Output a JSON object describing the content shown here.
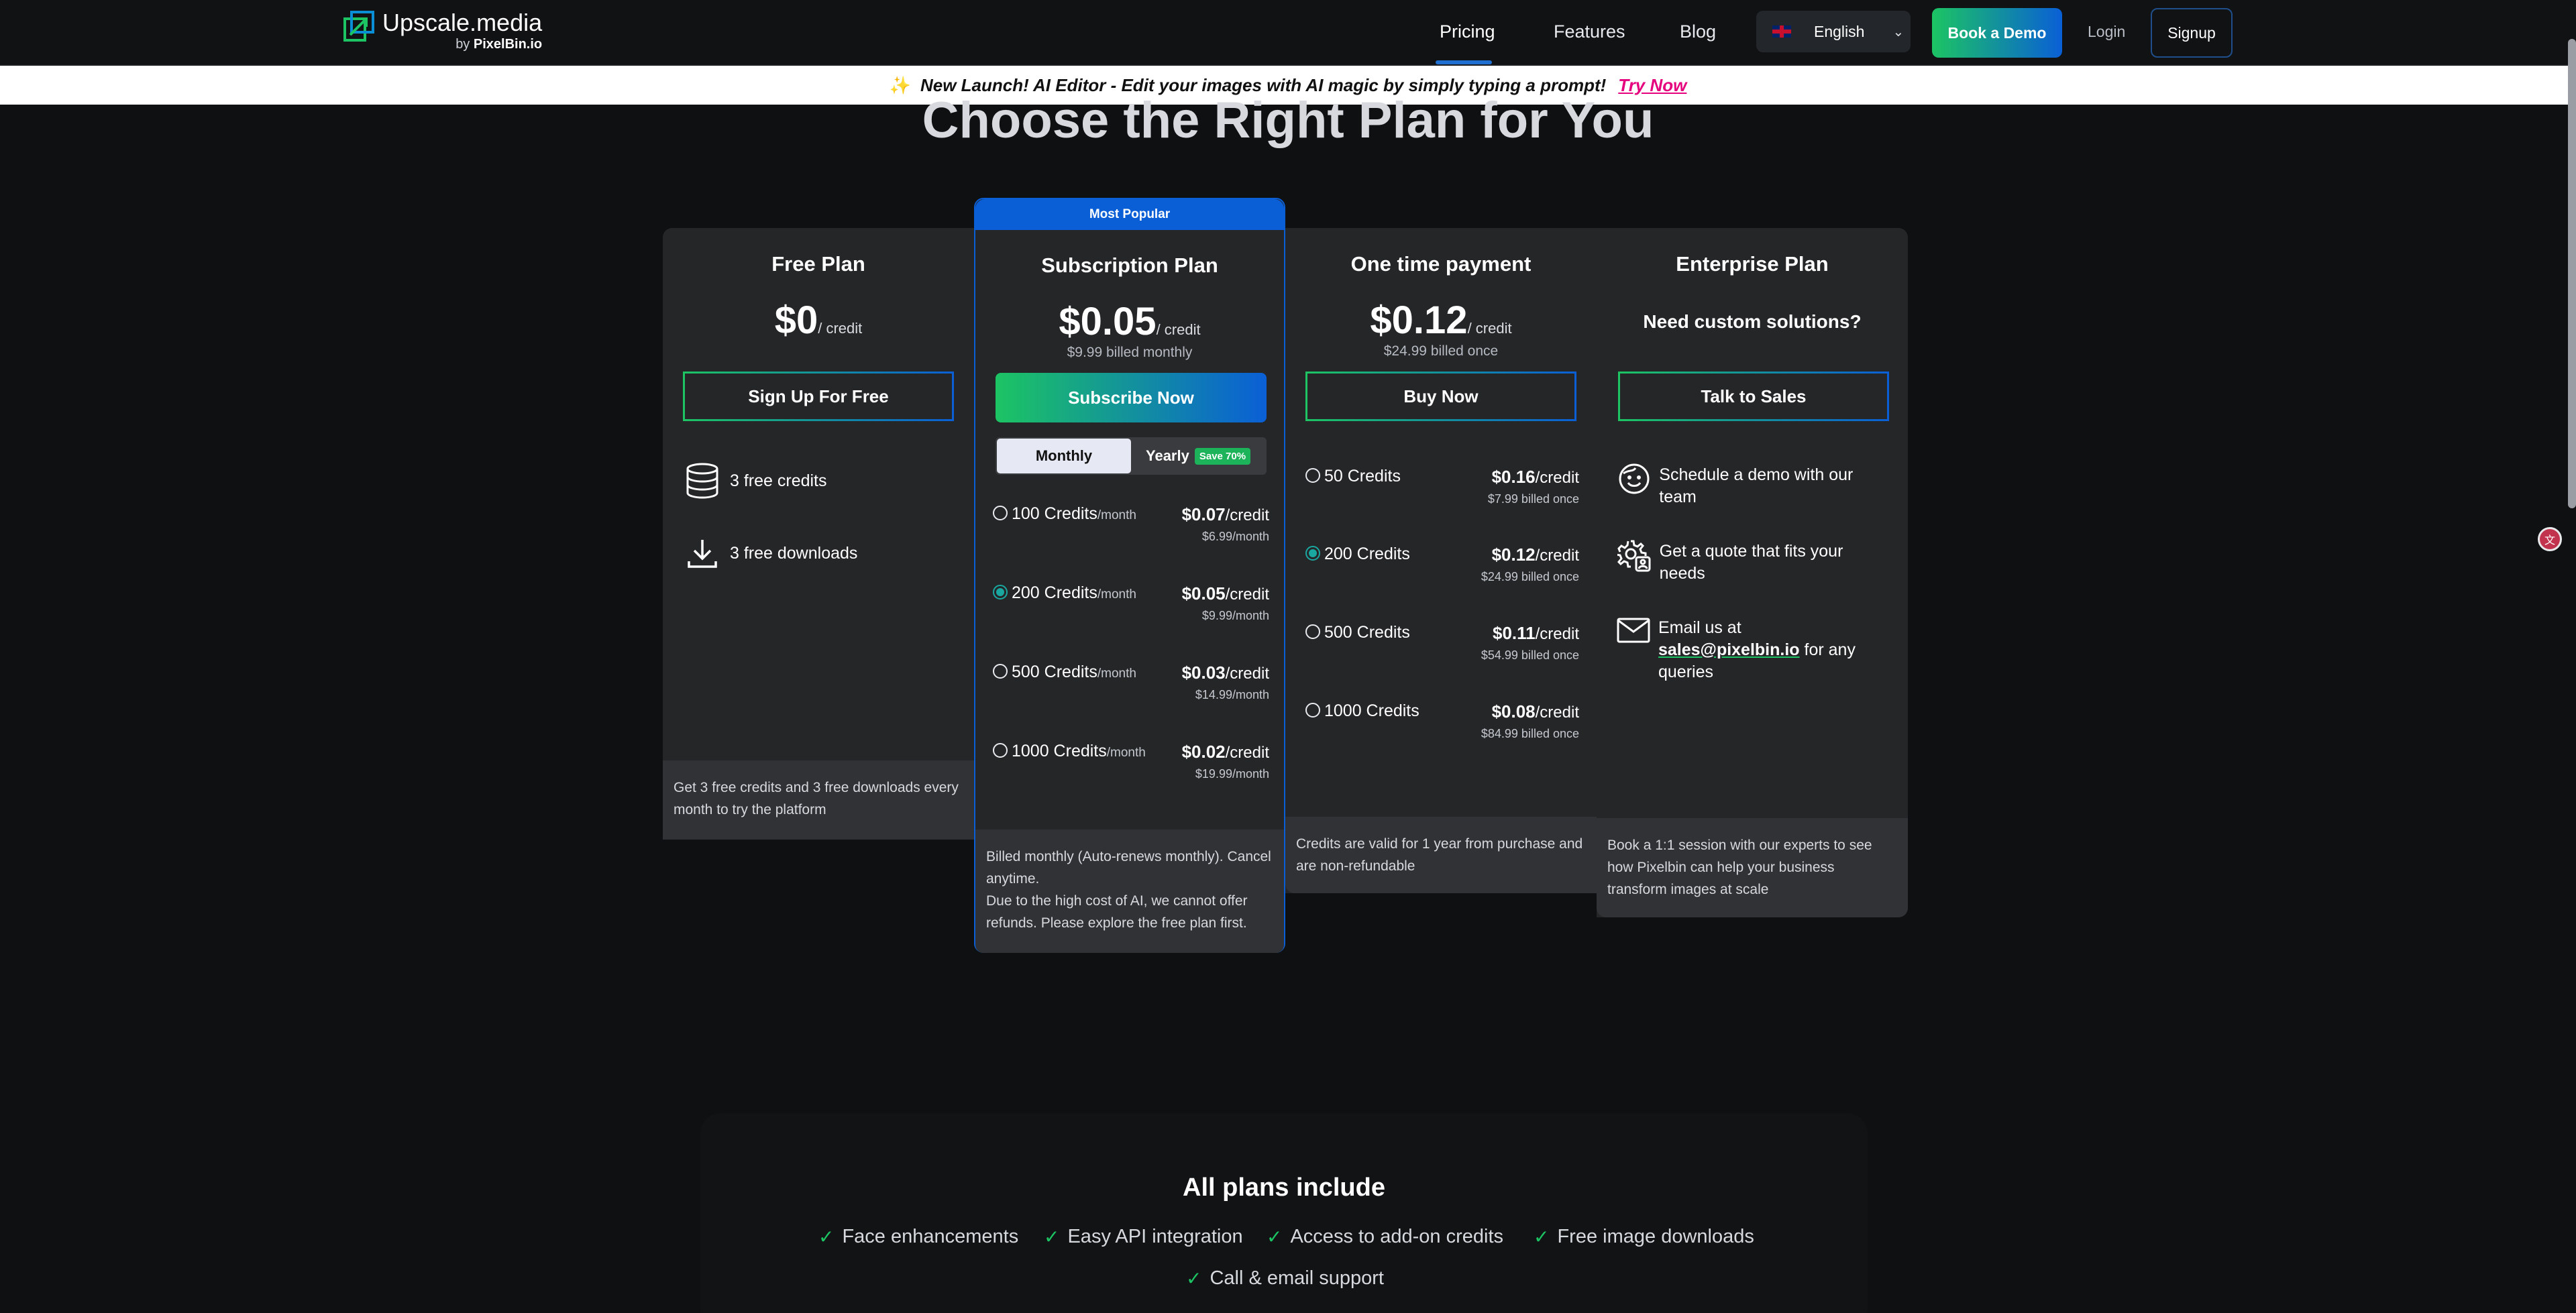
{
  "nav": {
    "brand": "Upscale.media",
    "brand_by": "by",
    "brand_sub": "PixelBin.io",
    "links": [
      "Pricing",
      "Features",
      "Blog"
    ],
    "language": "English",
    "book_demo": "Book a Demo",
    "login": "Login",
    "signup": "Signup"
  },
  "announcement": {
    "text": "New Launch! AI Editor - Edit your images with AI magic by simply typing a prompt!",
    "cta": "Try Now"
  },
  "page_title": "Choose the Right Plan for You",
  "plans": {
    "free": {
      "name": "Free Plan",
      "price": "$0",
      "unit": "/ credit",
      "cta": "Sign Up For Free",
      "features": [
        "3 free credits",
        "3 free downloads"
      ],
      "note": "Get 3 free credits and 3 free downloads every month to try the platform"
    },
    "subscription": {
      "badge": "Most Popular",
      "name": "Subscription Plan",
      "price": "$0.05",
      "unit": "/ credit",
      "billed": "$9.99 billed monthly",
      "cta": "Subscribe Now",
      "toggle_monthly": "Monthly",
      "toggle_yearly": "Yearly",
      "save_badge": "Save 70%",
      "tiers": [
        {
          "credits": "100 Credits",
          "per": "/month",
          "price": "$0.07",
          "unit": "/credit",
          "billed": "$6.99/month",
          "selected": false
        },
        {
          "credits": "200 Credits",
          "per": "/month",
          "price": "$0.05",
          "unit": "/credit",
          "billed": "$9.99/month",
          "selected": true
        },
        {
          "credits": "500 Credits",
          "per": "/month",
          "price": "$0.03",
          "unit": "/credit",
          "billed": "$14.99/month",
          "selected": false
        },
        {
          "credits": "1000 Credits",
          "per": "/month",
          "price": "$0.02",
          "unit": "/credit",
          "billed": "$19.99/month",
          "selected": false
        }
      ],
      "note_line1": "Billed monthly (Auto-renews monthly). Cancel anytime.",
      "note_line2": "Due to the high cost of AI, we cannot offer refunds. Please explore the free plan first."
    },
    "onetime": {
      "name": "One time payment",
      "price": "$0.12",
      "unit": "/ credit",
      "billed": "$24.99 billed once",
      "cta": "Buy Now",
      "tiers": [
        {
          "credits": "50 Credits",
          "price": "$0.16",
          "unit": "/credit",
          "billed": "$7.99 billed once",
          "selected": false
        },
        {
          "credits": "200 Credits",
          "price": "$0.12",
          "unit": "/credit",
          "billed": "$24.99 billed once",
          "selected": true
        },
        {
          "credits": "500 Credits",
          "price": "$0.11",
          "unit": "/credit",
          "billed": "$54.99 billed once",
          "selected": false
        },
        {
          "credits": "1000 Credits",
          "price": "$0.08",
          "unit": "/credit",
          "billed": "$84.99 billed once",
          "selected": false
        }
      ],
      "note": "Credits are valid for 1 year from purchase and are non-refundable"
    },
    "enterprise": {
      "name": "Enterprise Plan",
      "headline": "Need custom solutions?",
      "cta": "Talk to Sales",
      "features": [
        "Schedule a demo with our team",
        "Get a quote that fits your needs"
      ],
      "email_prefix": "Email us at",
      "email": "sales@pixelbin.io",
      "email_suffix": "for any queries",
      "note": "Book a 1:1 session with our experts to see how Pixelbin can help your business transform images at scale"
    }
  },
  "all_plans": {
    "title": "All plans include",
    "items": [
      "Face enhancements",
      "Easy API integration",
      "Access to add-on credits",
      "Free image downloads",
      "Call & email support"
    ]
  },
  "colors": {
    "background": "#0f1012",
    "card": "#252628",
    "accent_green": "#1cc463",
    "accent_blue": "#0a5fd6",
    "try_now": "#e5007e"
  }
}
